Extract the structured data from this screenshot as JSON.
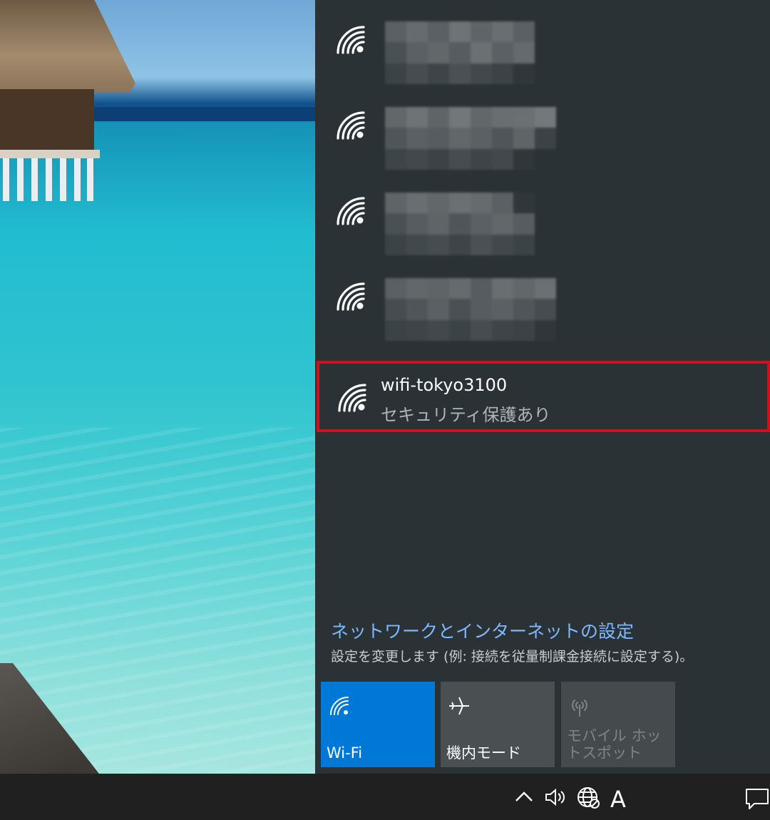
{
  "networks": {
    "hidden_count_note": "",
    "selected": {
      "ssid": "wifi-tokyo3100",
      "security": "セキュリティ保護あり"
    }
  },
  "settings": {
    "link": "ネットワークとインターネットの設定",
    "description": "設定を変更します (例: 接続を従量制課金接続に設定する)。"
  },
  "quick_actions": [
    {
      "label": "Wi-Fi",
      "icon": "wifi-icon",
      "state": "on"
    },
    {
      "label": "機内モード",
      "icon": "airplane-icon",
      "state": "off"
    },
    {
      "label": "モバイル ホットスポット",
      "icon": "hotspot-icon",
      "state": "disabled"
    }
  ],
  "tray": {
    "ime_label": "A",
    "icons": [
      "chevron-up-icon",
      "speaker-icon",
      "globe-icon",
      "notification-icon"
    ]
  },
  "colors": {
    "panel": "#2a3236",
    "accent": "#0078d7",
    "highlight_border": "#d0101e",
    "link": "#7fb8ff"
  }
}
